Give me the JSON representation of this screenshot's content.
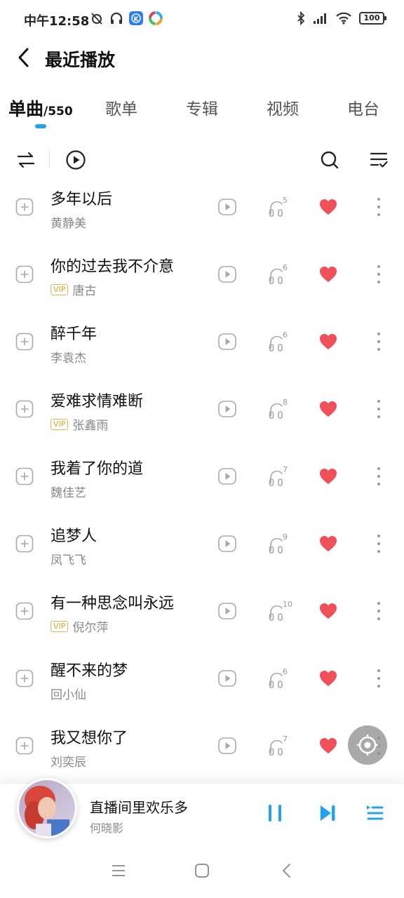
{
  "status": {
    "time": "中午12:58",
    "battery": "100",
    "left_icons": [
      "alarm-off-icon",
      "headphones-icon",
      "app-k-icon",
      "app-colorful-icon"
    ],
    "right_icons": [
      "bluetooth-icon",
      "signal-icon",
      "wifi-icon",
      "battery-icon"
    ]
  },
  "header": {
    "title": "最近播放"
  },
  "tabs": [
    {
      "label": "单曲",
      "count": "/550",
      "active": true
    },
    {
      "label": "歌单"
    },
    {
      "label": "专辑"
    },
    {
      "label": "视频"
    },
    {
      "label": "电台"
    }
  ],
  "toolbar": [
    "shuffle-icon",
    "play-all-icon",
    "search-icon",
    "manage-list-icon"
  ],
  "songs": [
    {
      "title": "多年以后",
      "artist": "黄静美",
      "vip": false,
      "hq": "5",
      "liked": true
    },
    {
      "title": "你的过去我不介意",
      "artist": "唐古",
      "vip": true,
      "hq": "6",
      "liked": true
    },
    {
      "title": "醉千年",
      "artist": "李袁杰",
      "vip": false,
      "hq": "6",
      "liked": true
    },
    {
      "title": "爱难求情难断",
      "artist": "张鑫雨",
      "vip": true,
      "hq": "8",
      "liked": true
    },
    {
      "title": "我着了你的道",
      "artist": "魏佳艺",
      "vip": false,
      "hq": "7",
      "liked": true
    },
    {
      "title": "追梦人",
      "artist": "凤飞飞",
      "vip": false,
      "hq": "9",
      "liked": true
    },
    {
      "title": "有一种思念叫永远",
      "artist": "倪尔萍",
      "vip": true,
      "hq": "10",
      "liked": true
    },
    {
      "title": "醒不来的梦",
      "artist": "回小仙",
      "vip": false,
      "hq": "6",
      "liked": true
    },
    {
      "title": "我又想你了",
      "artist": "刘奕辰",
      "vip": false,
      "hq": "7",
      "liked": true
    }
  ],
  "vip_label": "VIP",
  "now_playing": {
    "title": "直播间里欢乐多",
    "artist": "何晓影"
  },
  "colors": {
    "accent": "#22a3f0",
    "like": "#f0505a",
    "vip": "#d9a52a"
  }
}
